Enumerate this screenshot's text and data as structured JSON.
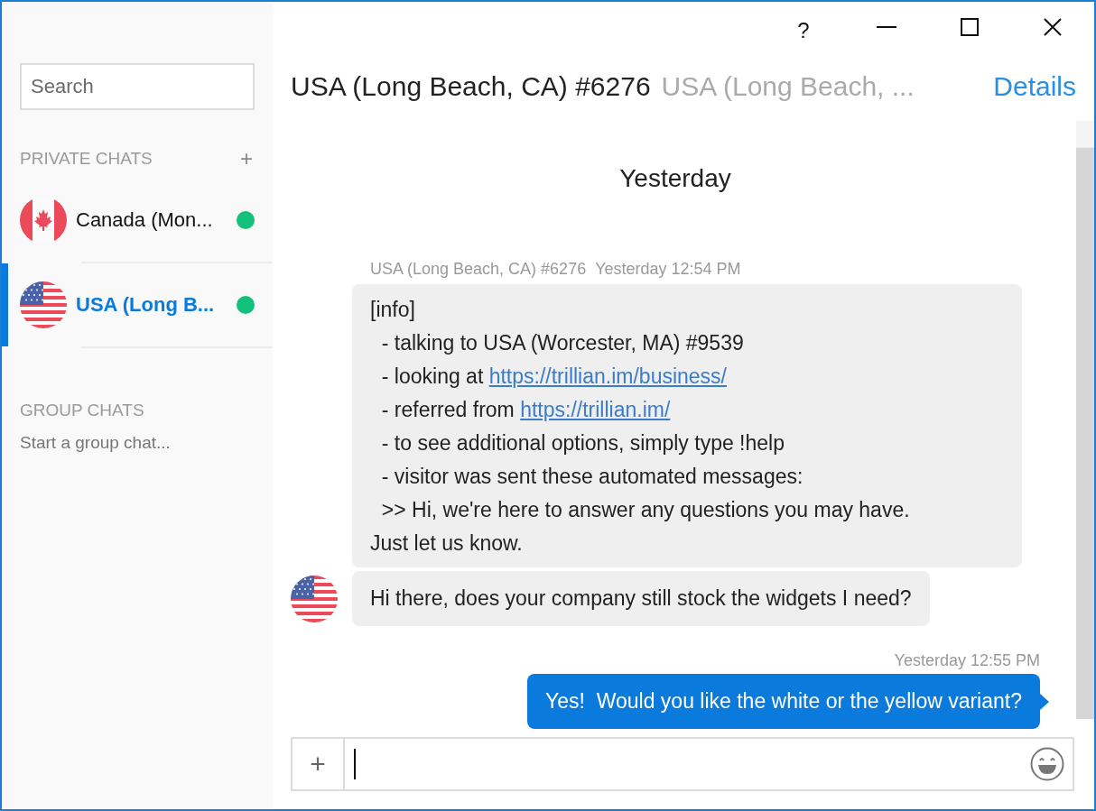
{
  "window": {
    "help": "?"
  },
  "sidebar": {
    "search": {
      "placeholder": "Search"
    },
    "private_chats": {
      "heading": "PRIVATE CHATS",
      "add": "+",
      "items": [
        {
          "name": "Canada (Mon...",
          "avatar": {
            "kind": "canada"
          },
          "online": true,
          "selected": false
        },
        {
          "name": "USA (Long B...",
          "avatar": {
            "kind": "usa"
          },
          "online": true,
          "selected": true
        }
      ]
    },
    "group_chats": {
      "heading": "GROUP CHATS",
      "action": "Start a group chat..."
    }
  },
  "header": {
    "title": "USA (Long Beach, CA) #6276",
    "subtitle": "USA (Long Beach, ...",
    "details": "Details"
  },
  "day_divider": "Yesterday",
  "messages": [
    {
      "kind": "info",
      "sender": "USA (Long Beach, CA) #6276",
      "time": "Yesterday 12:54 PM",
      "lines": [
        {
          "text": "[info]"
        },
        {
          "text": "  - talking to USA (Worcester, MA) #9539"
        },
        {
          "text": "  - looking at ",
          "link": "https://trillian.im/business/"
        },
        {
          "text": "  - referred from ",
          "link": "https://trillian.im/"
        },
        {
          "text": "  - to see additional options, simply type !help"
        },
        {
          "text": "  - visitor was sent these automated messages:"
        },
        {
          "text": "  >> Hi, we're here to answer any questions you may have."
        },
        {
          "text": "Just let us know."
        }
      ]
    },
    {
      "kind": "incoming",
      "avatar": {
        "kind": "usa"
      },
      "text": "Hi there, does your company still stock the widgets I need?"
    },
    {
      "kind": "outgoing",
      "time": "Yesterday 12:55 PM",
      "text": "Yes!  Would you like the white or the yellow variant?"
    }
  ],
  "composer": {
    "attach": "+"
  }
}
